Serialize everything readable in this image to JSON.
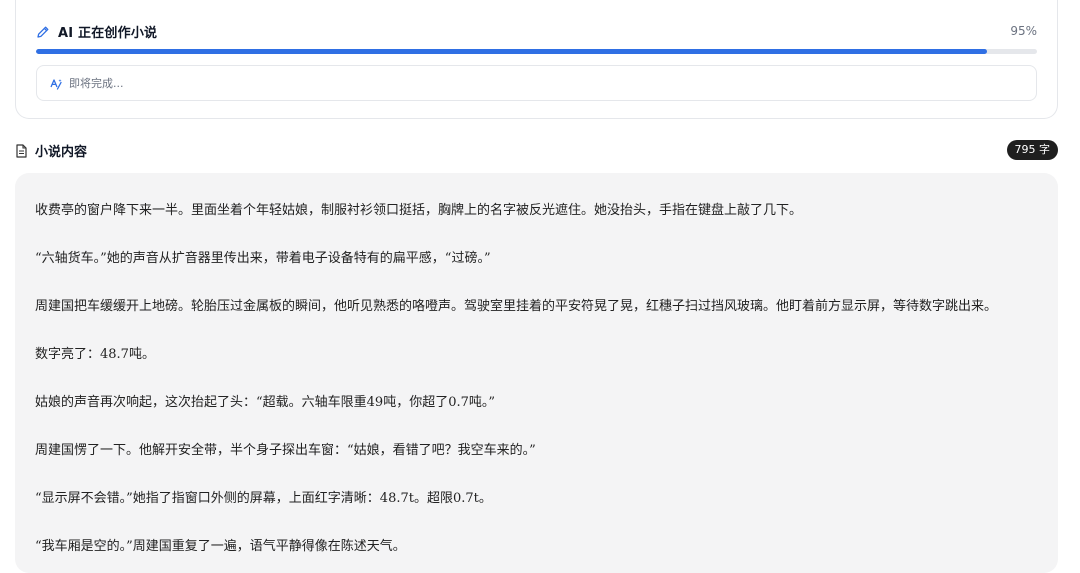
{
  "progress": {
    "title": "AI 正在创作小说",
    "percent_label": "95%",
    "percent_value": 95,
    "status_text": "即将完成...",
    "icon": "pencil-icon",
    "status_icon": "sparkle-icon",
    "accent_color": "#2f6fe4"
  },
  "novel": {
    "section_title": "小说内容",
    "section_icon": "document-icon",
    "word_count_label": "795 字",
    "paragraphs": [
      "收费亭的窗户降下来一半。里面坐着个年轻姑娘，制服衬衫领口挺括，胸牌上的名字被反光遮住。她没抬头，手指在键盘上敲了几下。",
      "“六轴货车。”她的声音从扩音器里传出来，带着电子设备特有的扁平感，“过磅。”",
      "周建国把车缓缓开上地磅。轮胎压过金属板的瞬间，他听见熟悉的咯噔声。驾驶室里挂着的平安符晃了晃，红穗子扫过挡风玻璃。他盯着前方显示屏，等待数字跳出来。",
      "数字亮了：48.7吨。",
      "姑娘的声音再次响起，这次抬起了头：“超载。六轴车限重49吨，你超了0.7吨。”",
      "周建国愣了一下。他解开安全带，半个身子探出车窗：“姑娘，看错了吧？我空车来的。”",
      "“显示屏不会错。”她指了指窗口外侧的屏幕，上面红字清晰：48.7t。超限0.7t。",
      "“我车厢是空的。”周建国重复了一遍，语气平静得像在陈述天气。"
    ]
  }
}
